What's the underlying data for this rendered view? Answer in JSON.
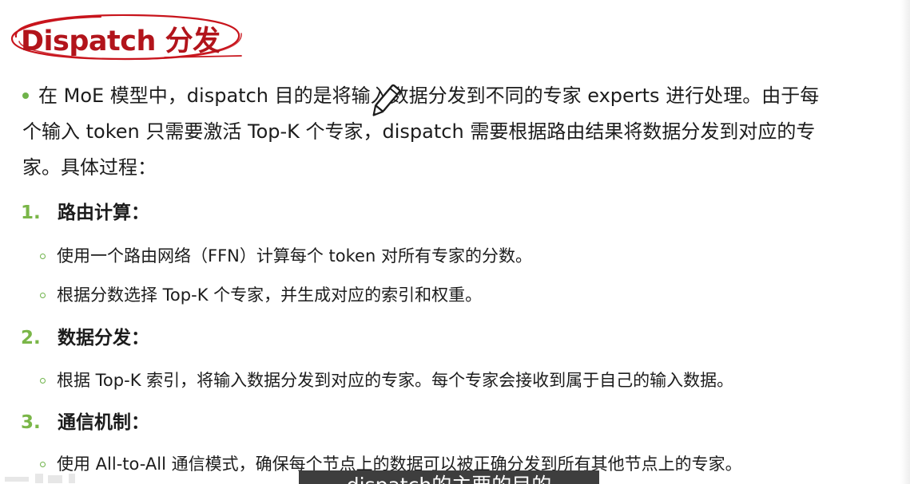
{
  "title": "Dispatch 分发",
  "intro": {
    "lines": [
      "在 MoE 模型中，dispatch  目的是将输入数据分发到不同的专家 experts 进行处理。由于每",
      "个输入 token 只需要激活 Top-K 个专家，dispatch 需要根据路由结果将数据分发到对应的专",
      "家。具体过程："
    ]
  },
  "sections": [
    {
      "number": "1.",
      "title": "路由计算：",
      "items": [
        "使用一个路由网络（FFN）计算每个 token 对所有专家的分数。",
        "根据分数选择 Top-K 个专家，并生成对应的索引和权重。"
      ]
    },
    {
      "number": "2.",
      "title": "数据分发：",
      "items": [
        "根据 Top-K 索引，将输入数据分发到对应的专家。每个专家会接收到属于自己的输入数据。"
      ]
    },
    {
      "number": "3.",
      "title": "通信机制：",
      "items": [
        "使用 All-to-All 通信模式，确保每个节点上的数据可以被正确分发到所有其他节点上的专家。"
      ]
    }
  ],
  "subtitle": "dispatch的主要的目的",
  "colors": {
    "title": "#b2141b",
    "bullet": "#6fb34a",
    "number": "#7ab648"
  },
  "icons": {
    "cursor": "pen-cursor-icon"
  }
}
